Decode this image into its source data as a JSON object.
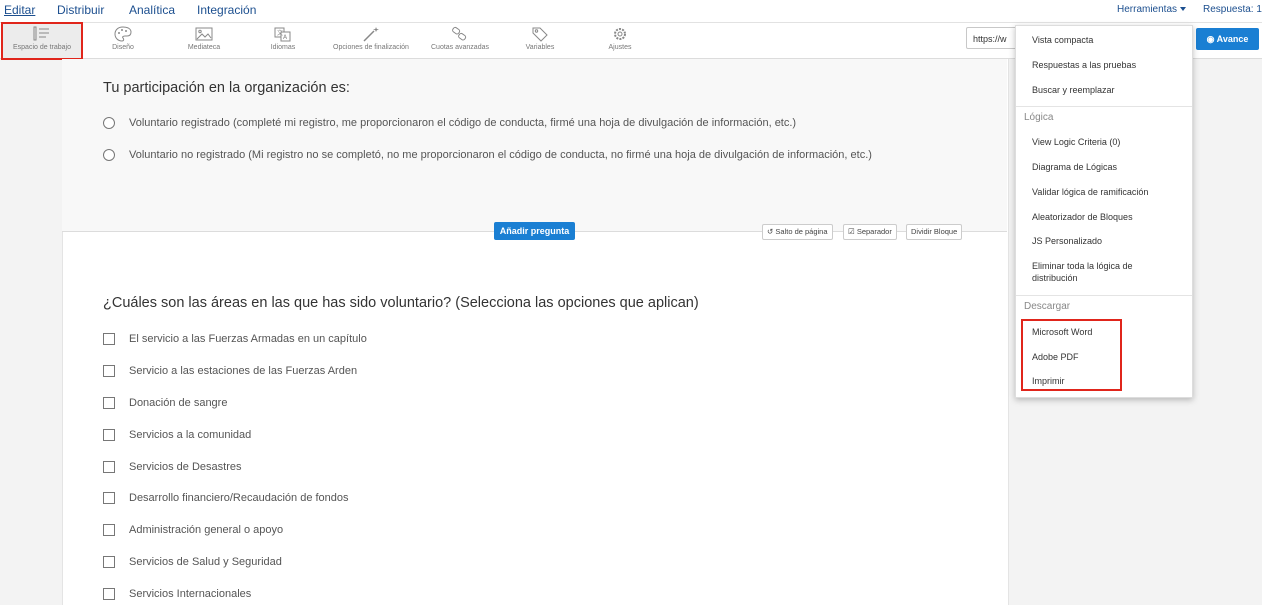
{
  "topnav": {
    "tabs": [
      "Editar",
      "Distribuir",
      "Analítica",
      "Integración"
    ],
    "tools_label": "Herramientas",
    "responses_label": "Respuesta: 1"
  },
  "toolbar": {
    "items": [
      {
        "label": "Espacio de trabajo",
        "icon": "workspace-icon"
      },
      {
        "label": "Diseño",
        "icon": "palette-icon"
      },
      {
        "label": "Mediateca",
        "icon": "image-icon"
      },
      {
        "label": "Idiomas",
        "icon": "translate-icon"
      },
      {
        "label": "Opciones de finalización",
        "icon": "magic-wand-icon"
      },
      {
        "label": "Cuotas avanzadas",
        "icon": "link-icon"
      },
      {
        "label": "Variables",
        "icon": "tag-icon"
      },
      {
        "label": "Ajustes",
        "icon": "gear-icon"
      }
    ],
    "url_value": "https://w",
    "preview_label": "Avance"
  },
  "question1": {
    "title": "Tu participación en la organización es:",
    "options": [
      "Voluntario registrado (completé mi registro, me proporcionaron el código de conducta, firmé una hoja de divulgación de información, etc.)",
      "Voluntario no registrado (Mi registro no se completó, no me proporcionaron el código de conducta, no firmé una hoja de divulgación de información, etc.)"
    ]
  },
  "block_actions": {
    "add_question": "Añadir pregunta",
    "page_break": "Salto de página",
    "separator": "Separador",
    "split_block": "Dividir Bloque"
  },
  "question2": {
    "title": "¿Cuáles son las áreas en las que has sido voluntario? (Selecciona las opciones que aplican)",
    "options": [
      "El servicio a las Fuerzas Armadas en un capítulo",
      "Servicio a las estaciones de las Fuerzas Arden",
      "Donación de sangre",
      "Servicios a la comunidad",
      "Servicios de Desastres",
      "Desarrollo financiero/Recaudación de fondos",
      "Administración general o apoyo",
      "Servicios de Salud y Seguridad",
      "Servicios Internacionales"
    ]
  },
  "menu": {
    "top_items": [
      "Vista compacta",
      "Respuestas a las pruebas",
      "Buscar y reemplazar"
    ],
    "logic_header": "Lógica",
    "logic_items": [
      "View Logic Criteria (0)",
      "Diagrama de Lógicas",
      "Validar lógica de ramificación",
      "Aleatorizador de Bloques",
      "JS Personalizado",
      "Eliminar toda la lógica de distribución"
    ],
    "download_header": "Descargar",
    "download_items": [
      "Microsoft Word",
      "Adobe PDF",
      "Imprimir"
    ]
  },
  "colors": {
    "accent": "#1a7fd3",
    "highlight": "#e0251b",
    "nav_link": "#1c4f8f"
  }
}
